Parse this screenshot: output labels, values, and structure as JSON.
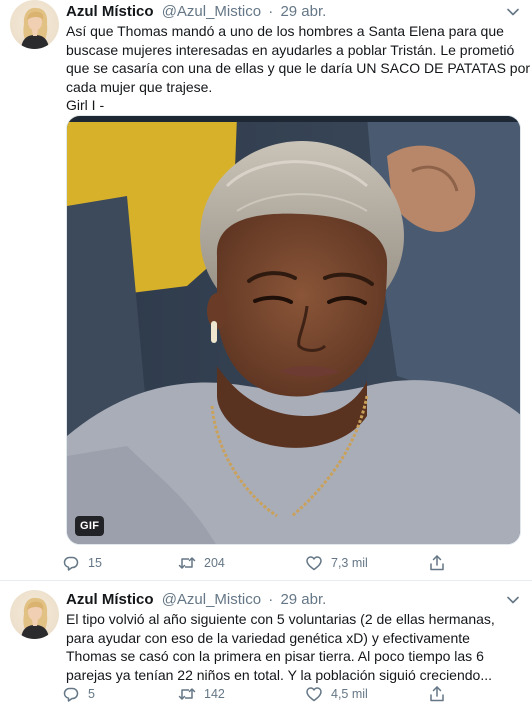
{
  "tweets": [
    {
      "author_name": "Azul Místico",
      "handle": "@Azul_Mistico",
      "separator": "·",
      "time": "29 abr.",
      "text_lines": [
        "Así que Thomas mandó a uno de los hombres a Santa Elena para que",
        "buscase mujeres interesadas en ayudarles a poblar Tristán. Le prometió",
        "que se casaría con una de ellas y que le daría UN SACO DE PATATAS por",
        "cada mujer que trajese.",
        "Girl I -"
      ],
      "media": {
        "type": "gif",
        "badge": "GIF"
      },
      "actions": {
        "replies": "15",
        "retweets": "204",
        "likes": "7,3 mil"
      }
    },
    {
      "author_name": "Azul Místico",
      "handle": "@Azul_Mistico",
      "separator": "·",
      "time": "29 abr.",
      "text_lines": [
        "El tipo volvió al año siguiente con 5 voluntarias (2 de ellas hermanas,",
        "para ayudar con eso de la variedad genética xD) y efectivamente",
        "Thomas se casó con la primera en pisar tierra. Al poco tiempo las 6",
        "parejas ya tenían 22 niños en total. Y la población siguió creciendo..."
      ],
      "actions": {
        "replies": "5",
        "retweets": "142",
        "likes": "4,5 mil"
      }
    }
  ],
  "icons": {
    "reply": "reply-icon",
    "retweet": "retweet-icon",
    "like": "heart-icon",
    "share": "share-icon",
    "caret": "chevron-down-icon"
  },
  "colors": {
    "text": "#14171a",
    "secondary": "#657786",
    "divider": "#e6ecf0"
  }
}
